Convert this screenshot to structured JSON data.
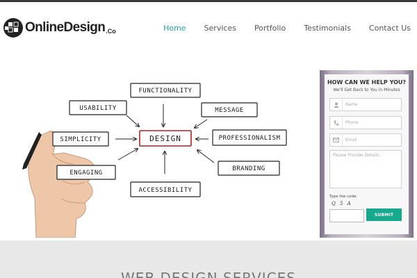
{
  "logo": {
    "name": "OnlineDesign",
    "suffix": ".Co"
  },
  "nav": {
    "items": [
      {
        "label": "Home",
        "active": true
      },
      {
        "label": "Services"
      },
      {
        "label": "Portfolio"
      },
      {
        "label": "Testimonials"
      },
      {
        "label": "Contact Us"
      }
    ],
    "active_color": "#26a69a"
  },
  "hero": {
    "center_word": "DESIGN",
    "words": {
      "functionality": "FUNCTIONALITY",
      "usability": "USABILITY",
      "message": "MESSAGE",
      "simplicity": "SIMPLICITY",
      "professionalism": "PROFESSIONALISM",
      "engaging": "ENGAGING",
      "branding": "BRANDING",
      "accessibility": "ACCESSIBILITY"
    }
  },
  "form": {
    "title": "HOW CAN WE HELP YOU?",
    "subtitle": "We'll Get Back to You in Minutes",
    "name_placeholder": "Name",
    "phone_placeholder": "Phone",
    "email_placeholder": "Email",
    "details_placeholder": "Please Provide Details:",
    "code_label": "Type the code:",
    "captcha": "Q 5 A",
    "submit_label": "SUBMIT",
    "submit_color": "#16a98e",
    "icons": {
      "name": "user-icon",
      "phone": "phone-icon",
      "email": "envelope-icon"
    }
  },
  "section": {
    "title": "WEB DESIGN SERVICES"
  }
}
